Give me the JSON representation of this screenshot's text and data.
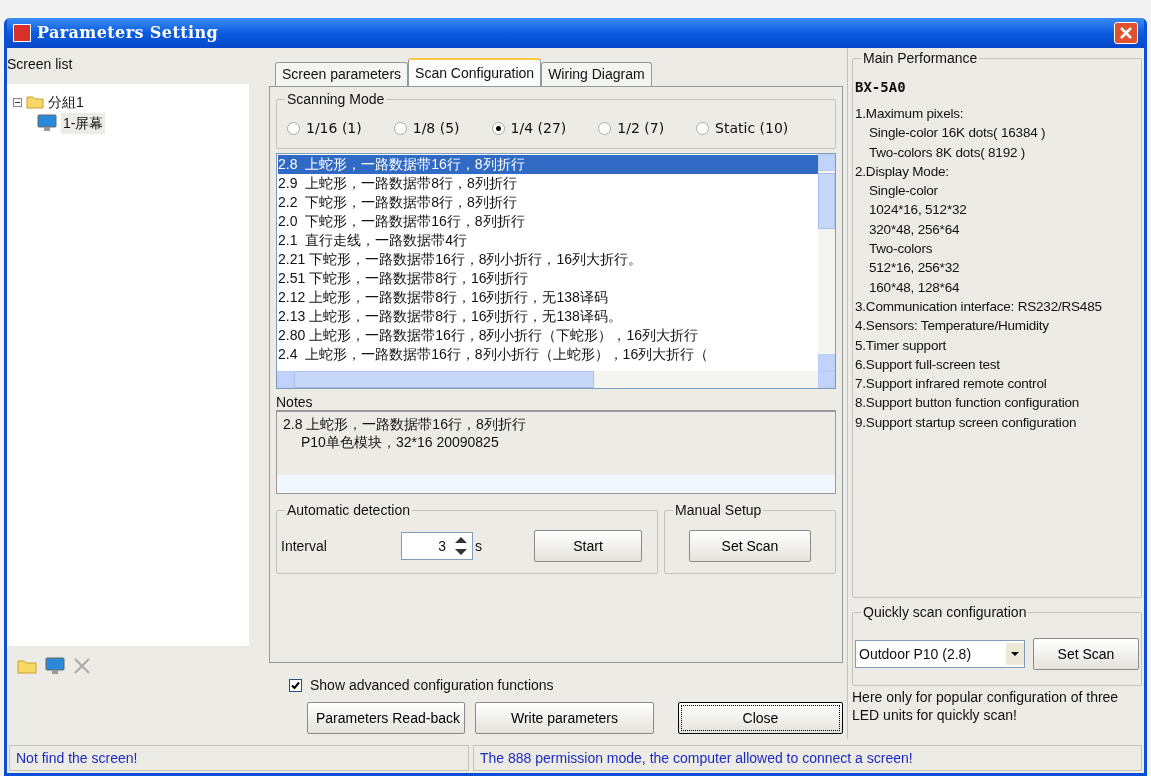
{
  "window": {
    "title": "Parameters Setting"
  },
  "screen_list": {
    "label": "Screen list",
    "tree": [
      {
        "label": "分組1",
        "expanded": true,
        "children": [
          {
            "label": "1-屏幕",
            "selected": true
          }
        ]
      }
    ]
  },
  "tabs": [
    {
      "label": "Screen parameters",
      "selected": false
    },
    {
      "label": "Scan Configuration",
      "selected": true
    },
    {
      "label": "Wiring Diagram",
      "selected": false
    }
  ],
  "scanning_mode": {
    "label": "Scanning Mode",
    "options": [
      {
        "label": "1/16 (1)",
        "selected": false
      },
      {
        "label": "1/8 (5)",
        "selected": false
      },
      {
        "label": "1/4 (27)",
        "selected": true
      },
      {
        "label": "1/2 (7)",
        "selected": false
      },
      {
        "label": "Static (10)",
        "selected": false
      }
    ]
  },
  "scan_list": [
    {
      "label": "2.8  上蛇形，一路数据带16行，8列折行",
      "selected": true
    },
    {
      "label": "2.9  上蛇形，一路数据带8行，8列折行",
      "selected": false
    },
    {
      "label": "2.2  下蛇形，一路数据带8行，8列折行",
      "selected": false
    },
    {
      "label": "2.0  下蛇形，一路数据带16行，8列折行",
      "selected": false
    },
    {
      "label": "2.1  直行走线，一路数据带4行",
      "selected": false
    },
    {
      "label": "2.21 下蛇形，一路数据带16行，8列小折行，16列大折行。",
      "selected": false
    },
    {
      "label": "2.51 下蛇形，一路数据带8行，16列折行",
      "selected": false
    },
    {
      "label": "2.12 上蛇形，一路数据带8行，16列折行，无138译码",
      "selected": false
    },
    {
      "label": "2.13 上蛇形，一路数据带8行，16列折行，无138译码。",
      "selected": false
    },
    {
      "label": "2.80 上蛇形，一路数据带16行，8列小折行（下蛇形），16列大折行",
      "selected": false
    },
    {
      "label": "2.4  上蛇形，一路数据带16行，8列小折行（上蛇形），16列大折行（",
      "selected": false
    }
  ],
  "notes": {
    "label": "Notes",
    "lines": [
      "2.8 上蛇形，一路数据带16行，8列折行",
      "P10单色模块，32*16 20090825"
    ]
  },
  "auto_detection": {
    "label": "Automatic detection",
    "interval_label": "Interval",
    "interval_value": "3",
    "unit": "s",
    "button": "Start"
  },
  "manual_setup": {
    "label": "Manual Setup",
    "button": "Set Scan"
  },
  "show_advanced": {
    "label": "Show advanced configuration functions",
    "checked": true
  },
  "buttons": [
    {
      "label": "Parameters Read-back",
      "focused": false
    },
    {
      "label": "Write parameters",
      "focused": false
    },
    {
      "label": "Close",
      "focused": true
    }
  ],
  "main_performance": {
    "label": "Main Performance",
    "model": "BX-5A0",
    "lines": [
      {
        "text": "1.Maximum pixels:",
        "kind": "item"
      },
      {
        "text": "Single-color 16K dots( 16384 )",
        "kind": "detail"
      },
      {
        "text": "Two-colors 8K dots( 8192 )",
        "kind": "detail"
      },
      {
        "text": "2.Display Mode:",
        "kind": "item"
      },
      {
        "text": "Single-color",
        "kind": "detail"
      },
      {
        "text": "1024*16, 512*32",
        "kind": "detail"
      },
      {
        "text": "320*48, 256*64",
        "kind": "detail"
      },
      {
        "text": "Two-colors",
        "kind": "detail"
      },
      {
        "text": "512*16, 256*32",
        "kind": "detail"
      },
      {
        "text": "160*48, 128*64",
        "kind": "detail"
      },
      {
        "text": "3.Communication interface: RS232/RS485",
        "kind": "item"
      },
      {
        "text": "4.Sensors: Temperature/Humidity",
        "kind": "item"
      },
      {
        "text": "5.Timer support",
        "kind": "item"
      },
      {
        "text": "6.Support full-screen test",
        "kind": "item"
      },
      {
        "text": "7.Support infrared remote control",
        "kind": "item"
      },
      {
        "text": "8.Support button function configuration",
        "kind": "item"
      },
      {
        "text": "9.Support startup screen configuration",
        "kind": "item"
      }
    ]
  },
  "quick_scan": {
    "label": "Quickly scan configuration",
    "select_value": "Outdoor P10 (2.8)",
    "button": "Set Scan",
    "note": "Here only for popular configuration of three LED units for quickly scan!"
  },
  "status_bar": [
    "Not find the screen!",
    "The 888 permission mode, the computer allowed to connect a screen!"
  ]
}
